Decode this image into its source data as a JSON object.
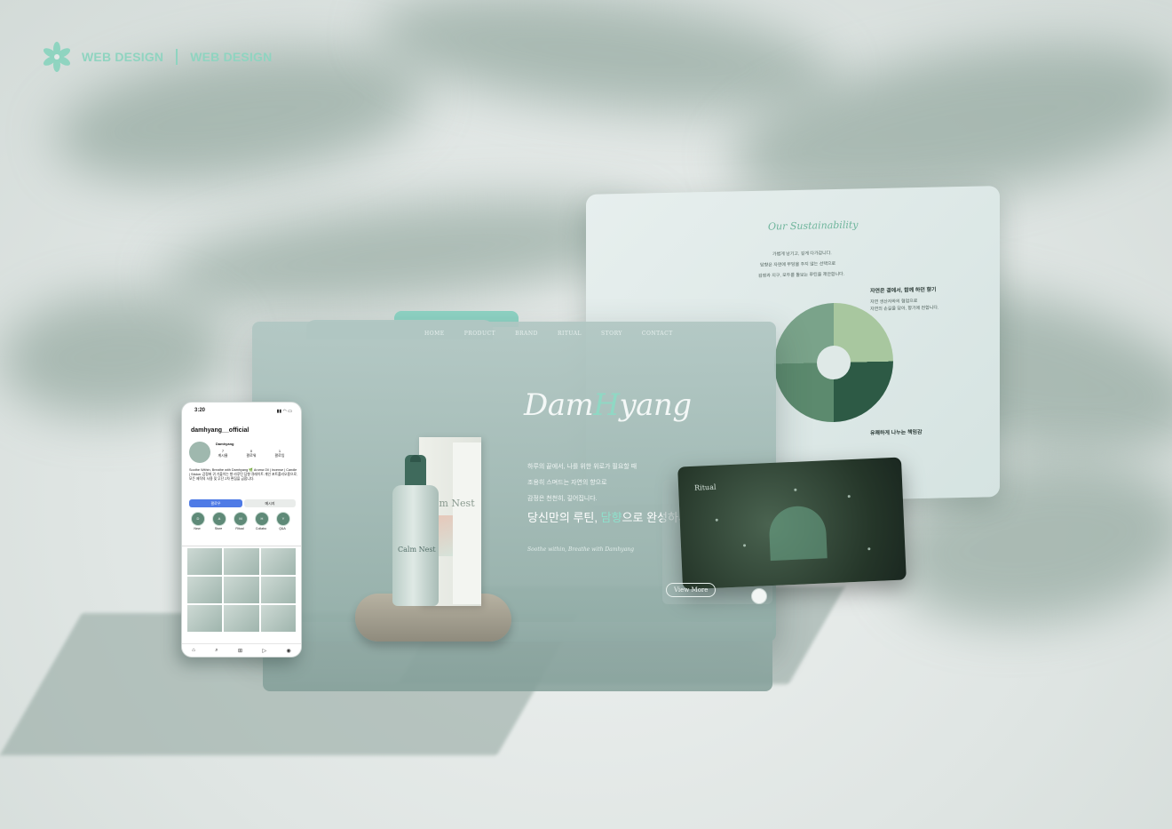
{
  "header": {
    "label_1": "WEB DESIGN",
    "label_2": "WEB DESIGN"
  },
  "sustainability": {
    "title": "Our Sustainability",
    "intro": [
      "가볍게 남기고, 깊게 다가갑니다.",
      "담향은 자연에 부담을 주지 않는 선택으로",
      "감정과 지구, 모두를 돌보는 루틴을 제안합니다."
    ],
    "section_1_head": "자연은 곁에서, 함께 하던 향기",
    "section_1_lines": [
      "자연 생산자와의 협업으로",
      "자연의 손길을 담아, 향기에 전합니다."
    ],
    "section_2_head": "유쾌하게 나누는 책임감",
    "section_2_lines": [
      "",
      ""
    ]
  },
  "main": {
    "nav": [
      "HOME",
      "PRODUCT",
      "BRAND",
      "RITUAL",
      "STORY",
      "CONTACT"
    ],
    "logo_part1": "Dam",
    "logo_h": "H",
    "logo_part2": "yang",
    "copy_1": "하루의 끝에서, 나를 위한 위로가 필요할 때",
    "copy_2": "조용히 스며드는 자연의 향으로",
    "copy_3": "감정은 천천히, 깊어집니다.",
    "big_a": "당신만의 루틴, ",
    "big_accent": "담향",
    "big_b": "으로 완성하세요.",
    "sub": "Soothe within, Breathe with Damhyang",
    "product_name": "Calm Nest",
    "bottle_name": "Calm Nest"
  },
  "ritual_card": {
    "title": "Ritual",
    "view_more": "View More"
  },
  "phone": {
    "time": "3:20",
    "status_icons": "▮▮ ◠ ▭",
    "username": "damhyang__official",
    "display_name": "Damhyang",
    "stats": [
      {
        "value": "7",
        "label": "게시물"
      },
      {
        "value": "0",
        "label": "팔로워"
      },
      {
        "value": "1",
        "label": "팔로잉"
      }
    ],
    "bio": "Soothe Within, Breathe with Damhyang 🌿 Aroma Oil | Incense | Candle | Sticker 감정에 귀 기울이는 향 라루틴 담향 큐레이트 개인 포트폴리오용으로, 모든 제작의 사용 및 무단 2차 편집을 금합니다.",
    "follow_btn": "팔로우",
    "message_btn": "메시지",
    "highlights": [
      {
        "initial": "D",
        "label": "New"
      },
      {
        "initial": "A",
        "label": "Store"
      },
      {
        "initial": "M",
        "label": "Ritual"
      },
      {
        "initial": "H",
        "label": "Collabo"
      },
      {
        "initial": "Y",
        "label": "Q&A"
      }
    ],
    "nav": [
      "⌂",
      "⌕",
      "⊞",
      "▷",
      "◉"
    ]
  }
}
